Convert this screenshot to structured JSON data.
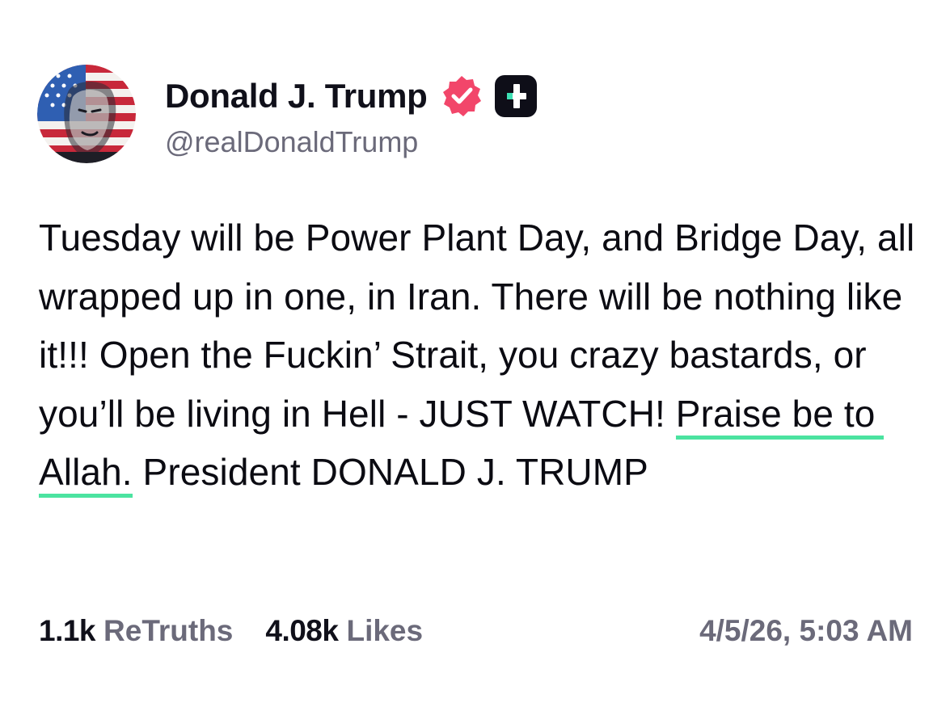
{
  "author": {
    "display_name": "Donald J. Trump",
    "handle": "@realDonaldTrump",
    "verified_icon": "verified-badge-icon",
    "plus_icon": "plus-badge-icon",
    "avatar": "flag-portrait-avatar"
  },
  "post": {
    "text_before": "Tuesday will be Power Plant Day, and Bridge Day, all wrapped up in one, in Iran. There will be nothing like it!!! Open the Fuckin’ Strait, you crazy bastards, or you’ll be living in Hell - JUST WATCH! ",
    "highlighted": "Praise be to Allah.",
    "text_after": " President DONALD J. TRUMP"
  },
  "stats": {
    "retruths_count": "1.1k",
    "retruths_label": "ReTruths",
    "likes_count": "4.08k",
    "likes_label": "Likes"
  },
  "timestamp": "4/5/26, 5:03 AM",
  "colors": {
    "highlight_underline": "#4be3a0",
    "verified_badge": "#f2466a",
    "muted_text": "#6b6a7a",
    "plus_badge_bg": "#0e0e18",
    "plus_badge_accent": "#3de0b4"
  }
}
